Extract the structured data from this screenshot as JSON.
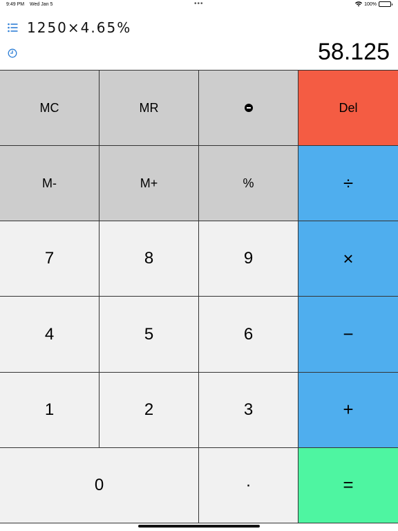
{
  "status_bar": {
    "time": "9:49 PM",
    "date": "Wed Jan 5",
    "dots": "•••",
    "battery": "100%"
  },
  "display": {
    "expression": "1250×4.65%",
    "result": "58.125"
  },
  "keys": {
    "mc": "MC",
    "mr": "MR",
    "del": "Del",
    "m_minus": "M-",
    "m_plus": "M+",
    "percent": "%",
    "divide": "÷",
    "seven": "7",
    "eight": "8",
    "nine": "9",
    "multiply": "×",
    "four": "4",
    "five": "5",
    "six": "6",
    "minus": "−",
    "one": "1",
    "two": "2",
    "three": "3",
    "plus": "+",
    "zero": "0",
    "decimal": "·",
    "equals": "="
  },
  "colors": {
    "memory_key": "#cdcdcd",
    "number_key": "#f1f1f1",
    "operator_key": "#4faeee",
    "delete_key": "#f45c43",
    "equals_key": "#4ef5a1",
    "accent_icon": "#2f7fd6"
  }
}
